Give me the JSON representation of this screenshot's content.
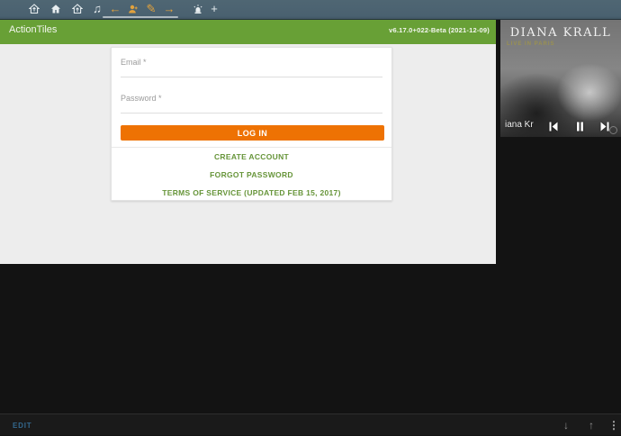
{
  "topbar": {
    "icons": [
      {
        "name": "home-export-icon"
      },
      {
        "name": "home-icon"
      },
      {
        "name": "home-upload-icon"
      },
      {
        "name": "music-note-icon",
        "glyph": "♫"
      },
      {
        "name": "back-icon",
        "glyph": "←"
      },
      {
        "name": "account-icon"
      },
      {
        "name": "edit-pencil-icon",
        "glyph": "✎"
      },
      {
        "name": "forward-icon",
        "glyph": "→"
      },
      {
        "name": "siren-icon"
      },
      {
        "name": "new-tab-icon",
        "glyph": "+"
      }
    ]
  },
  "header": {
    "app_title": "ActionTiles",
    "version": "v6.17.0+022-Beta (2021-12-09)",
    "bg_color": "#68a036"
  },
  "login": {
    "email_label": "Email *",
    "password_label": "Password *",
    "email_value": "",
    "password_value": "",
    "login_button": "LOG IN",
    "create_account": "CREATE ACCOUNT",
    "forgot_password": "FORGOT PASSWORD",
    "terms": "TERMS OF SERVICE (UPDATED FEB 15, 2017)",
    "button_color": "#ee7203",
    "link_color": "#67953a"
  },
  "media": {
    "album_title": "DIANA KRALL",
    "album_subtitle": "LIVE IN PARIS",
    "track_text": "iana Kr",
    "controls": [
      "skip-previous",
      "pause",
      "skip-next"
    ]
  },
  "bottom_bar": {
    "edit_label": "EDIT",
    "edit_color": "#33688e",
    "down_glyph": "↓",
    "up_glyph": "↑",
    "menu_glyph": "⋮"
  }
}
